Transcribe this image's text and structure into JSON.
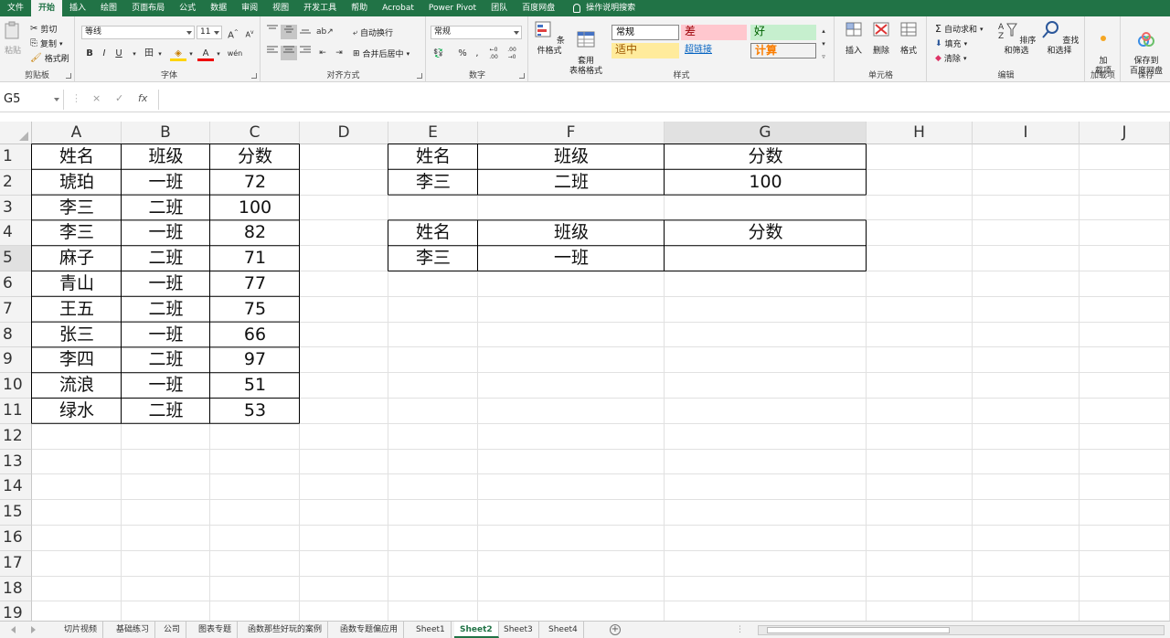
{
  "ribbon_tabs": [
    "文件",
    "开始",
    "插入",
    "绘图",
    "页面布局",
    "公式",
    "数据",
    "审阅",
    "视图",
    "开发工具",
    "帮助",
    "Acrobat",
    "Power Pivot",
    "团队",
    "百度网盘",
    "操作说明搜索"
  ],
  "active_tab_index": 1,
  "clipboard": {
    "paste": "粘贴",
    "cut": "剪切",
    "copy": "复制",
    "format_painter": "格式刷",
    "label": "剪贴板"
  },
  "font": {
    "name": "等线",
    "size": "11",
    "bold": "B",
    "italic": "I",
    "underline": "U",
    "grow": "A",
    "shrink": "A",
    "border": "田",
    "fill": "◈",
    "color": "A",
    "phonetic": "wén",
    "label": "字体"
  },
  "alignment": {
    "wrap": "自动换行",
    "merge": "合并后居中",
    "label": "对齐方式"
  },
  "number": {
    "format": "常规",
    "percent": "%",
    "comma": ",",
    "inc_dec": "←0 .00",
    "dec_dec": ".00 →0",
    "label": "数字"
  },
  "styles": {
    "conditional": "条件格式",
    "table": "套用\n表格格式",
    "normal": "常规",
    "bad": "差",
    "good": "好",
    "neutral": "适中",
    "hyperlink": "超链接",
    "calc": "计算",
    "label": "样式"
  },
  "cells_group": {
    "insert": "插入",
    "delete": "删除",
    "format": "格式",
    "label": "单元格"
  },
  "editing": {
    "autosum": "自动求和",
    "fill": "填充",
    "clear": "清除",
    "sort": "排序和筛选",
    "find": "查找和选择",
    "label": "编辑"
  },
  "addins": {
    "btn": "加\n载项",
    "label": "加载项"
  },
  "save": {
    "btn": "保存到\n百度网盘",
    "label": "保存"
  },
  "formula_bar": {
    "name_box": "G5",
    "cancel": "×",
    "enter": "✓",
    "fx": "fx",
    "value": ""
  },
  "columns": [
    "A",
    "B",
    "C",
    "D",
    "E",
    "F",
    "G",
    "H",
    "I",
    "J"
  ],
  "rows": [
    "1",
    "2",
    "3",
    "4",
    "5",
    "6",
    "7",
    "8",
    "9",
    "10",
    "11",
    "12",
    "13",
    "14",
    "15",
    "16",
    "17",
    "18",
    "19"
  ],
  "table_main": {
    "headers": [
      "姓名",
      "班级",
      "分数"
    ],
    "rows": [
      [
        "琥珀",
        "一班",
        "72"
      ],
      [
        "李三",
        "二班",
        "100"
      ],
      [
        "李三",
        "一班",
        "82"
      ],
      [
        "麻子",
        "二班",
        "71"
      ],
      [
        "青山",
        "一班",
        "77"
      ],
      [
        "王五",
        "二班",
        "75"
      ],
      [
        "张三",
        "一班",
        "66"
      ],
      [
        "李四",
        "二班",
        "97"
      ],
      [
        "流浪",
        "一班",
        "51"
      ],
      [
        "绿水",
        "二班",
        "53"
      ]
    ]
  },
  "lookup1": {
    "headers": [
      "姓名",
      "班级",
      "分数"
    ],
    "row": [
      "李三",
      "二班",
      "100"
    ]
  },
  "lookup2": {
    "headers": [
      "姓名",
      "班级",
      "分数"
    ],
    "row": [
      "李三",
      "一班",
      ""
    ]
  },
  "sheet_tabs": [
    "切片视频",
    "基础练习",
    "公司",
    "图表专题",
    "函数那些好玩的案例",
    "函数专题偏应用",
    "Sheet1",
    "Sheet2",
    "Sheet3",
    "Sheet4"
  ],
  "active_sheet_index": 7,
  "selected_cell": "G5"
}
